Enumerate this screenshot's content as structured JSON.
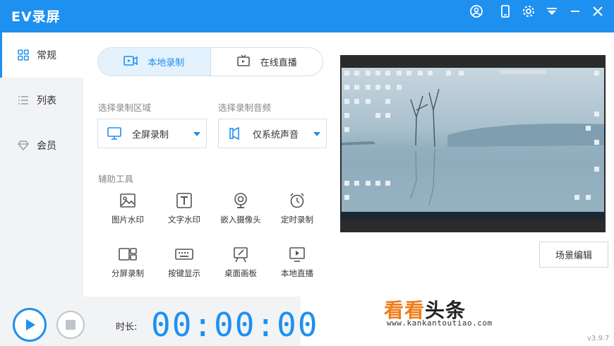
{
  "app": {
    "title": "EV录屏"
  },
  "titlebar": {
    "icons": [
      "user-icon",
      "phone-icon",
      "settings-gear-icon",
      "dropdown-menu-icon",
      "minimize-icon",
      "close-icon"
    ],
    "accent_color": "#1e90f0"
  },
  "sidebar": {
    "items": [
      {
        "label": "常规",
        "icon": "grid-icon",
        "active": true
      },
      {
        "label": "列表",
        "icon": "list-icon",
        "active": false
      },
      {
        "label": "会员",
        "icon": "diamond-icon",
        "active": false
      }
    ]
  },
  "mode_tabs": [
    {
      "label": "本地录制",
      "icon": "camera-icon",
      "active": true
    },
    {
      "label": "在线直播",
      "icon": "tv-icon",
      "active": false
    }
  ],
  "record_area": {
    "label": "选择录制区域",
    "value": "全屏录制",
    "icon": "monitor-icon"
  },
  "record_audio": {
    "label": "选择录制音频",
    "value": "仅系统声音",
    "icon": "speaker-icon"
  },
  "tools": {
    "label": "辅助工具",
    "items": [
      {
        "label": "图片水印",
        "icon": "image-icon"
      },
      {
        "label": "文字水印",
        "icon": "text-icon"
      },
      {
        "label": "嵌入摄像头",
        "icon": "webcam-icon"
      },
      {
        "label": "定时录制",
        "icon": "alarm-clock-icon"
      },
      {
        "label": "分屏录制",
        "icon": "split-screen-icon"
      },
      {
        "label": "按键显示",
        "icon": "keyboard-icon"
      },
      {
        "label": "桌面画板",
        "icon": "easel-icon"
      },
      {
        "label": "本地直播",
        "icon": "play-screen-icon"
      }
    ]
  },
  "preview": {
    "button_label": "场景编辑"
  },
  "bottom": {
    "duration_label": "时长:",
    "timer": "00:00:00",
    "version": "v3.9.7"
  },
  "watermark": {
    "title_orange": "看看",
    "title_dark": "头条",
    "url": "www.kankantoutiao.com"
  }
}
